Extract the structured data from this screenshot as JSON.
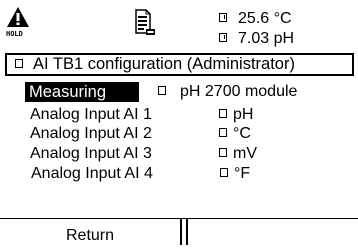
{
  "status": {
    "hold_label": "HOLD",
    "readings": [
      "25.6 °C",
      "7.03 pH"
    ]
  },
  "title": "AI TB1 configuration (Administrator)",
  "measuring": {
    "label": "Measuring",
    "value": "pH 2700 module"
  },
  "inputs": [
    {
      "label": "Analog Input AI 1",
      "value": "pH"
    },
    {
      "label": "Analog Input AI 2",
      "value": "°C"
    },
    {
      "label": "Analog Input AI 3",
      "value": "mV"
    },
    {
      "label": "Analog Input AI 4",
      "value": "°F"
    }
  ],
  "softkeys": {
    "left": "Return",
    "right": ""
  },
  "icons": {
    "hold": "hold-warning-icon",
    "document": "parameter-document-icon",
    "field_marker": "square-marker-icon"
  },
  "colors": {
    "foreground": "#000000",
    "background": "#ffffff",
    "highlight_bg": "#000000",
    "highlight_fg": "#ffffff"
  }
}
